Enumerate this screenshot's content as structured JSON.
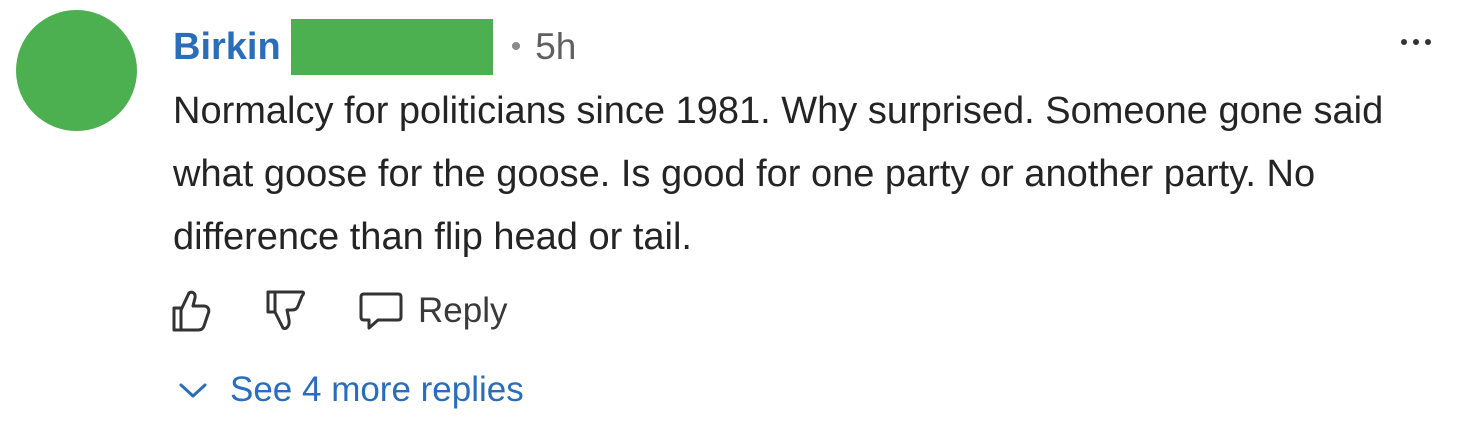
{
  "comment": {
    "author": "Birkin",
    "separator": "•",
    "time": "5h",
    "text": "Normalcy for politicians since 1981. Why surprised. Someone gone said what goose for the goose. Is good for one party or another party. No difference than flip head or tail.",
    "avatar_color": "#4caf50",
    "redaction_color": "#4caf50"
  },
  "actions": {
    "like_icon": "thumbs-up-icon",
    "dislike_icon": "thumbs-down-icon",
    "reply_icon": "speech-bubble-icon",
    "reply_label": "Reply",
    "more_icon": "ellipsis-icon"
  },
  "replies": {
    "icon": "chevron-down-icon",
    "label": "See 4 more replies"
  },
  "colors": {
    "accent": "#2a6ebb",
    "text": "#242424",
    "muted": "#5f5f5f"
  }
}
